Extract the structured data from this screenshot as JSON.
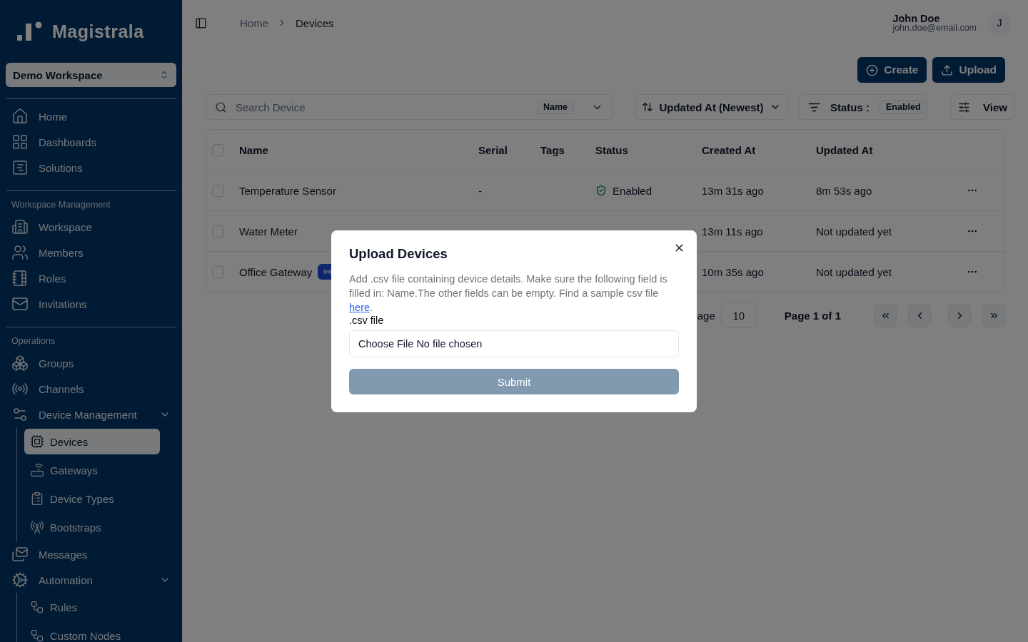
{
  "sidebar": {
    "logo_text": "Magistrala",
    "workspace_selector": "Demo Workspace",
    "sections": [
      {
        "items": [
          {
            "label": "Home",
            "selected": false
          },
          {
            "label": "Dashboards",
            "selected": false
          },
          {
            "label": "Solutions",
            "selected": false
          }
        ]
      },
      {
        "label": "Workspace Management",
        "items": [
          {
            "label": "Workspace",
            "selected": false
          },
          {
            "label": "Members",
            "selected": false
          },
          {
            "label": "Roles",
            "selected": false
          },
          {
            "label": "Invitations",
            "selected": false
          }
        ]
      },
      {
        "label": "Operations",
        "items": [
          {
            "label": "Groups",
            "selected": false
          },
          {
            "label": "Channels",
            "selected": false
          },
          {
            "label": "Device Management",
            "selected": false,
            "expanded": true,
            "children": [
              {
                "label": "Devices",
                "selected": true
              },
              {
                "label": "Gateways",
                "selected": false
              },
              {
                "label": "Device Types",
                "selected": false
              },
              {
                "label": "Bootstraps",
                "selected": false
              }
            ]
          },
          {
            "label": "Messages",
            "selected": false
          },
          {
            "label": "Automation",
            "selected": false,
            "expanded": true,
            "children": [
              {
                "label": "Rules",
                "selected": false
              },
              {
                "label": "Custom Nodes",
                "selected": false
              }
            ]
          }
        ]
      }
    ]
  },
  "header": {
    "breadcrumbs": [
      "Home",
      "Devices"
    ],
    "user": {
      "name": "John Doe",
      "email": "john.doe@email.com",
      "avatar": "J"
    }
  },
  "actions": [
    "Create",
    "Upload"
  ],
  "filters": {
    "search": {
      "placeholder": "Search Device",
      "field": "Name"
    },
    "sort": "Updated At (Newest)",
    "status_label": "Status :",
    "status_value": "Enabled",
    "view": "View"
  },
  "table": {
    "all_checked": false,
    "columns": [
      "Name",
      "Serial",
      "Tags",
      "Status",
      "Created At",
      "Updated At"
    ],
    "rows": [
      {
        "checked": false,
        "name": "Temperature Sensor",
        "serial": "-",
        "status": "Enabled",
        "created_at": "13m 31s ago",
        "updated_at": "8m 53s ago"
      },
      {
        "checked": false,
        "name": "Water Meter",
        "created_at": "13m 11s ago",
        "updated_at": "Not updated yet"
      },
      {
        "checked": false,
        "name": "Office Gateway",
        "has_badge": true,
        "created_at": "10m 35s ago",
        "updated_at": "Not updated yet"
      }
    ]
  },
  "pagination": {
    "rows_label": "age",
    "rows_value": "10",
    "page": "Page 1 of 1"
  },
  "dialog": {
    "title": "Upload Devices",
    "description": "Add .csv file containing device details. Make sure the following field is filled in: Name.The other fields can be empty. Find a sample csv file ",
    "link": "here",
    "after_link": ".",
    "field_label": ".csv file",
    "file_button": "Choose File",
    "file_value": "No file chosen",
    "submit": "Submit",
    "submit_disabled": true
  }
}
